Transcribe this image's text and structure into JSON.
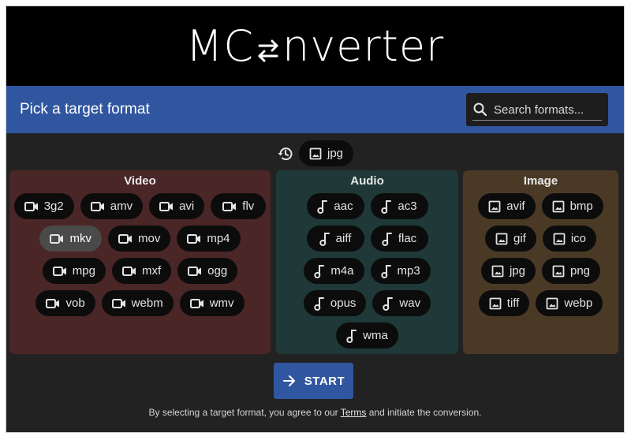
{
  "header": {
    "logo_pre": "MC",
    "logo_post": "nverter",
    "logo_icon": "swap-arrows-icon"
  },
  "bar": {
    "title": "Pick a target format",
    "search_placeholder": "Search formats..."
  },
  "recent": {
    "icon": "history-icon",
    "formats": [
      "jpg"
    ]
  },
  "categories": {
    "video": {
      "title": "Video",
      "icon": "video-camera-icon",
      "formats": [
        "3g2",
        "amv",
        "avi",
        "flv",
        "mkv",
        "mov",
        "mp4",
        "mpg",
        "mxf",
        "ogg",
        "vob",
        "webm",
        "wmv"
      ],
      "selected": "mkv"
    },
    "audio": {
      "title": "Audio",
      "icon": "music-note-icon",
      "formats": [
        "aac",
        "ac3",
        "aiff",
        "flac",
        "m4a",
        "mp3",
        "opus",
        "wav",
        "wma"
      ]
    },
    "image": {
      "title": "Image",
      "icon": "image-icon",
      "formats": [
        "avif",
        "bmp",
        "gif",
        "ico",
        "jpg",
        "png",
        "tiff",
        "webp"
      ]
    }
  },
  "start_button": {
    "label": "START",
    "icon": "arrow-right-icon"
  },
  "footer": {
    "text_before": "By selecting a target format, you agree to our ",
    "link": "Terms",
    "text_after": " and initiate the conversion."
  },
  "colors": {
    "accent": "#3056a0",
    "background": "#222222",
    "video_panel": "#4b2626",
    "audio_panel": "#1f3838",
    "image_panel": "#4a3a25",
    "chip": "#0c0c0c",
    "chip_selected": "#4a4a4a"
  }
}
